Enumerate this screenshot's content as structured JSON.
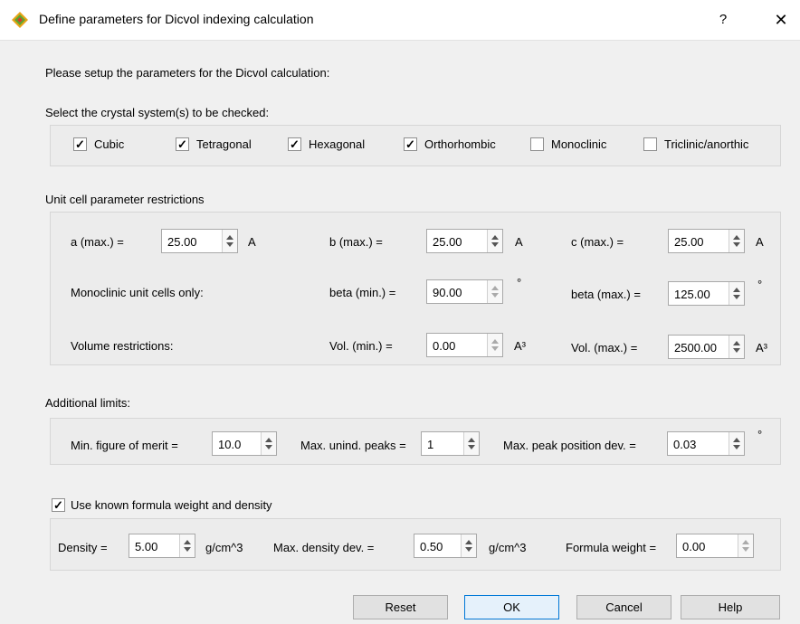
{
  "window": {
    "title": "Define parameters for Dicvol indexing calculation",
    "help_glyph": "?",
    "close_glyph": "✕"
  },
  "intro": "Please setup the parameters for the Dicvol calculation:",
  "crystal": {
    "label": "Select the crystal system(s) to be checked:",
    "items": [
      {
        "label": "Cubic",
        "checked": true
      },
      {
        "label": "Tetragonal",
        "checked": true
      },
      {
        "label": "Hexagonal",
        "checked": true
      },
      {
        "label": "Orthorhombic",
        "checked": true
      },
      {
        "label": "Monoclinic",
        "checked": false
      },
      {
        "label": "Triclinic/anorthic",
        "checked": false
      }
    ]
  },
  "unitcell": {
    "label": "Unit cell parameter restrictions",
    "a_label": "a (max.) =",
    "a_value": "25.00",
    "a_unit": "A",
    "b_label": "b (max.) =",
    "b_value": "25.00",
    "b_unit": "A",
    "c_label": "c (max.) =",
    "c_value": "25.00",
    "c_unit": "A",
    "mono_label": "Monoclinic unit cells only:",
    "betamin_label": "beta (min.) =",
    "betamin_value": "90.00",
    "betamin_unit": "°",
    "betamax_label": "beta (max.) =",
    "betamax_value": "125.00",
    "betamax_unit": "°",
    "vol_label": "Volume restrictions:",
    "volmin_label": "Vol. (min.) =",
    "volmin_value": "0.00",
    "volmin_unit": "A³",
    "volmax_label": "Vol. (max.) =",
    "volmax_value": "2500.00",
    "volmax_unit": "A³"
  },
  "additional": {
    "label": "Additional limits:",
    "fom_label": "Min. figure of merit =",
    "fom_value": "10.0",
    "unind_label": "Max. unind. peaks =",
    "unind_value": "1",
    "dev_label": "Max. peak position dev. =",
    "dev_value": "0.03",
    "dev_unit": "°"
  },
  "formula": {
    "check_label": "Use known formula weight and density",
    "checked": true,
    "density_label": "Density =",
    "density_value": "5.00",
    "density_unit": "g/cm^3",
    "ddev_label": "Max. density dev. =",
    "ddev_value": "0.50",
    "ddev_unit": "g/cm^3",
    "fw_label": "Formula weight =",
    "fw_value": "0.00"
  },
  "buttons": {
    "reset": "Reset",
    "ok": "OK",
    "cancel": "Cancel",
    "help": "Help"
  },
  "colors": {
    "accent": "#0078d7",
    "background": "#f0f0f0",
    "group": "#ececec"
  }
}
